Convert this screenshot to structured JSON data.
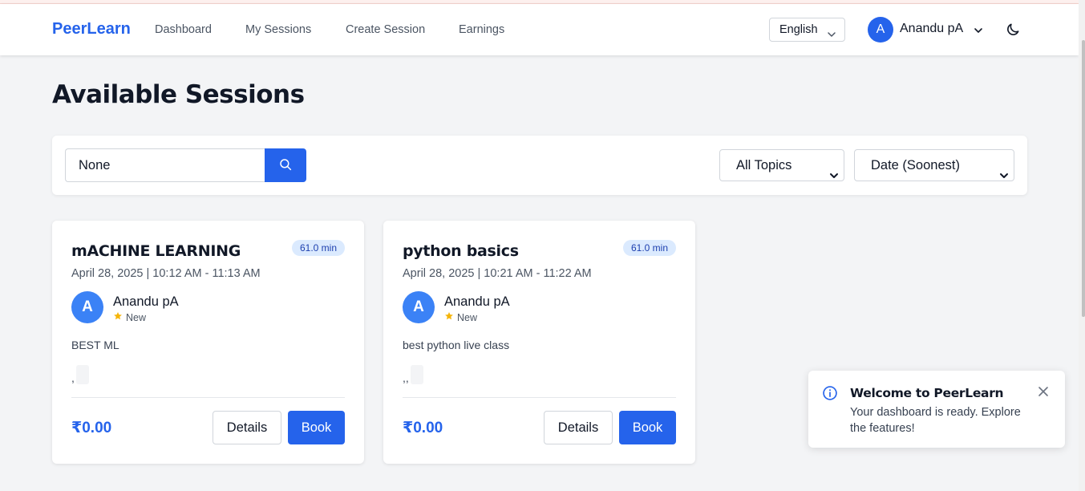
{
  "navbar": {
    "brand": "PeerLearn",
    "links": [
      {
        "label": "Dashboard"
      },
      {
        "label": "My Sessions"
      },
      {
        "label": "Create Session"
      },
      {
        "label": "Earnings"
      }
    ],
    "language": "English",
    "user": {
      "initial": "A",
      "name": "Anandu pA"
    },
    "icons": {
      "language_chevron": "chevron-down-icon",
      "user_chevron": "chevron-down-icon",
      "theme_toggle": "moon-icon"
    }
  },
  "page": {
    "title": "Available Sessions"
  },
  "filters": {
    "search_value": "None",
    "search_icon": "search-icon",
    "topic": "All Topics",
    "sort": "Date (Soonest)"
  },
  "sessions": [
    {
      "title": "mACHINE LEARNING",
      "duration": "61.0 min",
      "datetime": "April 28, 2025 | 10:12 AM - 11:13 AM",
      "host_initial": "A",
      "host_name": "Anandu pA",
      "host_rating": "New",
      "description": "BEST ML",
      "tags_text": ",",
      "price": "₹0.00",
      "details_label": "Details",
      "book_label": "Book"
    },
    {
      "title": "python basics",
      "duration": "61.0 min",
      "datetime": "April 28, 2025 | 10:21 AM - 11:22 AM",
      "host_initial": "A",
      "host_name": "Anandu pA",
      "host_rating": "New",
      "description": "best python live class",
      "tags_text": ",,",
      "price": "₹0.00",
      "details_label": "Details",
      "book_label": "Book"
    }
  ],
  "toast": {
    "title": "Welcome to PeerLearn",
    "message": "Your dashboard is ready. Explore the features!",
    "icon": "info-icon",
    "close_icon": "close-icon"
  },
  "colors": {
    "accent": "#2563eb",
    "badge_bg": "#dbeafe",
    "star": "#f5b50a",
    "page_bg": "#f3f4f6"
  }
}
